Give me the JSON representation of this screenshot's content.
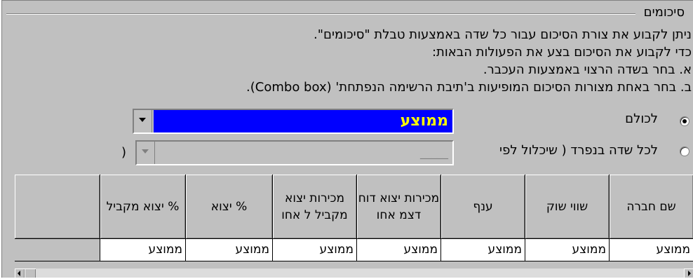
{
  "group": {
    "title": "סיכומים"
  },
  "description": [
    "ניתן לקבוע את צורת הסיכום עבור כל שדה באמצעות טבלת \"סיכומים\".",
    "כדי לקבוע את הסיכום בצע את הפעולות הבאות:",
    "א. בחר בשדה הרצוי באמצעות העכבר.",
    "ב. בחר באחת מצורות הסיכום המופיעות ב'תיבת הרשימה הנפתחת' (Combo box)."
  ],
  "options": {
    "all": {
      "label": "לכולם",
      "selected": true,
      "combo_value": "ממוצע"
    },
    "each": {
      "label": "לכל שדה בנפרד  ( שיכלול לפי",
      "selected": false,
      "combo_value": "_____",
      "close_paren": ")"
    }
  },
  "colors": {
    "selection_bg": "#0000ff",
    "selection_fg": "#ffff00"
  },
  "table": {
    "headers": [
      "שם חברה",
      "שווי שוק",
      "ענף",
      "מכירות יצוא דוח דצמ אחו",
      "מכירות יצוא מקביל ל אחו",
      "% יצוא",
      "% יצוא מקביל",
      ""
    ],
    "row": [
      "ממוצע",
      "ממוצע",
      "ממוצע",
      "ממוצע",
      "ממוצע",
      "ממוצע",
      "ממוצע",
      ""
    ]
  }
}
